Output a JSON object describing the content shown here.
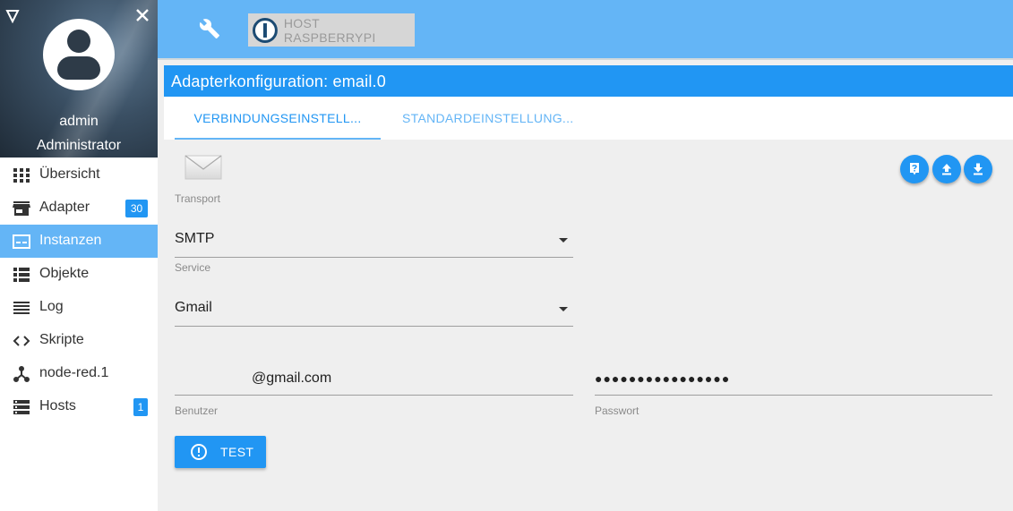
{
  "user": {
    "name": "admin",
    "role": "Administrator"
  },
  "nav": {
    "items": [
      {
        "label": "Übersicht",
        "icon": "grid-icon"
      },
      {
        "label": "Adapter",
        "icon": "store-icon",
        "badge": "30"
      },
      {
        "label": "Instanzen",
        "icon": "instances-icon",
        "active": true
      },
      {
        "label": "Objekte",
        "icon": "list-icon"
      },
      {
        "label": "Log",
        "icon": "lines-icon"
      },
      {
        "label": "Skripte",
        "icon": "code-icon"
      },
      {
        "label": "node-red.1",
        "icon": "node-icon"
      },
      {
        "label": "Hosts",
        "icon": "server-icon",
        "badge": "1"
      }
    ]
  },
  "topbar": {
    "host_label": "HOST RASPBERRYPI"
  },
  "config": {
    "title": "Adapterkonfiguration: email.0",
    "tabs": [
      "VERBINDUNGSEINSTELL...",
      "STANDARDEINSTELLUNG..."
    ]
  },
  "form": {
    "transport_label": "Transport",
    "transport_value": "SMTP",
    "service_label": "Service",
    "service_value": "Gmail",
    "user_value": "@gmail.com",
    "user_label": "Benutzer",
    "password_value": "●●●●●●●●●●●●●●●●",
    "password_label": "Passwort",
    "test_label": "TEST"
  },
  "colors": {
    "primary": "#2196f3",
    "light": "#64b5f6",
    "active_nav": "#64b5f6"
  }
}
